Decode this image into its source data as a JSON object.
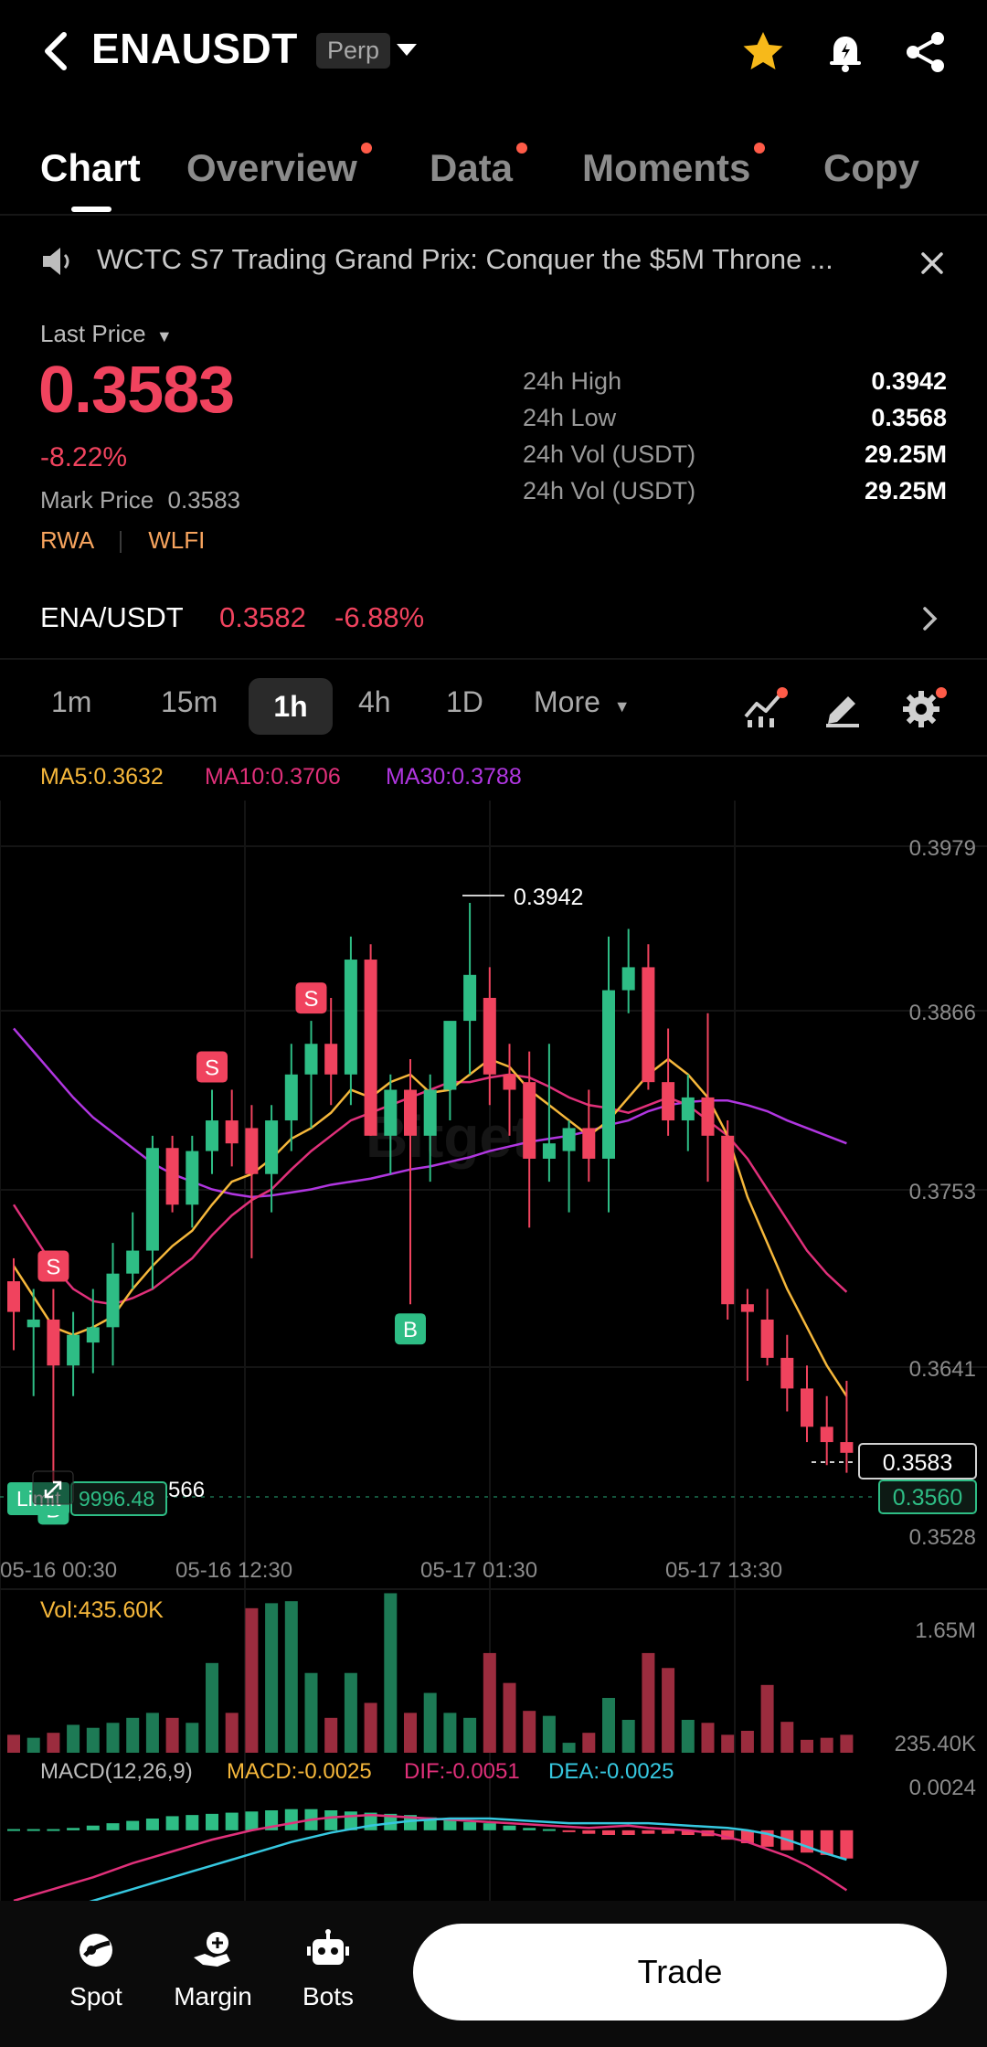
{
  "header": {
    "symbol": "ENAUSDT",
    "contract_type": "Perp"
  },
  "tabs": [
    {
      "label": "Chart"
    },
    {
      "label": "Overview"
    },
    {
      "label": "Data"
    },
    {
      "label": "Moments"
    },
    {
      "label": "Copy"
    }
  ],
  "announcement": {
    "text": "WCTC S7 Trading Grand Prix: Conquer the $5M Throne ..."
  },
  "price": {
    "selector_label": "Last Price",
    "last_price": "0.3583",
    "change_pct": "-8.22%",
    "mark_price_label": "Mark Price",
    "mark_price": "0.3583",
    "tags": [
      "RWA",
      "WLFI"
    ],
    "stats": [
      {
        "label": "24h High",
        "value": "0.3942"
      },
      {
        "label": "24h Low",
        "value": "0.3568"
      },
      {
        "label": "24h Vol (USDT)",
        "value": "29.25M"
      },
      {
        "label": "24h Vol (USDT)",
        "value": "29.25M"
      }
    ]
  },
  "pair": {
    "name": "ENA/USDT",
    "price": "0.3582",
    "change": "-6.88%"
  },
  "intervals": [
    "1m",
    "15m",
    "1h",
    "4h",
    "1D",
    "More"
  ],
  "colors": {
    "up": "#2ebd85",
    "down": "#f0435e",
    "ma5": "#f5b73b",
    "ma10": "#e0307a",
    "ma30": "#b036e0",
    "dea": "#36c8e0",
    "accent_dot": "#ff5b48",
    "star": "#f7b91a"
  },
  "icons": [
    "back-arrow-icon",
    "star-icon",
    "bell-icon",
    "share-icon",
    "speaker-icon",
    "close-icon",
    "chevron-right-icon",
    "indicator-icon",
    "pencil-icon",
    "gear-icon",
    "spot-icon",
    "margin-icon",
    "bots-icon"
  ],
  "chart": {
    "ma_legend": {
      "ma5": "MA5:0.3632",
      "ma10": "MA10:0.3706",
      "ma30": "MA30:0.3788"
    },
    "y_ticks": [
      "0.3979",
      "0.3866",
      "0.3753",
      "0.3641",
      "0.3528"
    ],
    "x_ticks": [
      "05-16 00:30",
      "05-16 12:30",
      "05-17 01:30",
      "05-17 13:30"
    ],
    "high_marker": "0.3942",
    "last_price_tag": "0.3583",
    "order_price_tag": "0.3560",
    "order": {
      "type": "Limit",
      "qty": "9996.48",
      "price_fragment": "566"
    },
    "vol_label": "Vol:435.60K",
    "vol_ticks": [
      "1.65M",
      "235.40K"
    ],
    "macd": {
      "label": "MACD(12,26,9)",
      "macd": "MACD:-0.0025",
      "dif": "DIF:-0.0051",
      "dea": "DEA:-0.0025",
      "tick": "0.0024"
    },
    "trade_markers": [
      "S",
      "S",
      "S",
      "B",
      "B"
    ]
  },
  "chart_data": {
    "type": "candlestick",
    "y_range": [
      0.3528,
      0.3979
    ],
    "candles": [
      {
        "o": 0.3695,
        "h": 0.371,
        "l": 0.365,
        "c": 0.3675
      },
      {
        "o": 0.3665,
        "h": 0.369,
        "l": 0.362,
        "c": 0.367
      },
      {
        "o": 0.367,
        "h": 0.369,
        "l": 0.356,
        "c": 0.364
      },
      {
        "o": 0.364,
        "h": 0.3675,
        "l": 0.362,
        "c": 0.366
      },
      {
        "o": 0.3655,
        "h": 0.369,
        "l": 0.3635,
        "c": 0.3665
      },
      {
        "o": 0.3665,
        "h": 0.372,
        "l": 0.364,
        "c": 0.37
      },
      {
        "o": 0.37,
        "h": 0.374,
        "l": 0.369,
        "c": 0.3715
      },
      {
        "o": 0.3715,
        "h": 0.379,
        "l": 0.369,
        "c": 0.3782
      },
      {
        "o": 0.3782,
        "h": 0.379,
        "l": 0.374,
        "c": 0.3745
      },
      {
        "o": 0.3745,
        "h": 0.379,
        "l": 0.373,
        "c": 0.378
      },
      {
        "o": 0.378,
        "h": 0.382,
        "l": 0.3765,
        "c": 0.38
      },
      {
        "o": 0.38,
        "h": 0.382,
        "l": 0.377,
        "c": 0.3785
      },
      {
        "o": 0.3795,
        "h": 0.381,
        "l": 0.371,
        "c": 0.3765
      },
      {
        "o": 0.3765,
        "h": 0.381,
        "l": 0.374,
        "c": 0.38
      },
      {
        "o": 0.38,
        "h": 0.385,
        "l": 0.378,
        "c": 0.383
      },
      {
        "o": 0.383,
        "h": 0.3865,
        "l": 0.3795,
        "c": 0.385
      },
      {
        "o": 0.385,
        "h": 0.388,
        "l": 0.381,
        "c": 0.383
      },
      {
        "o": 0.383,
        "h": 0.392,
        "l": 0.381,
        "c": 0.3905
      },
      {
        "o": 0.3905,
        "h": 0.3915,
        "l": 0.379,
        "c": 0.379
      },
      {
        "o": 0.379,
        "h": 0.383,
        "l": 0.3765,
        "c": 0.382
      },
      {
        "o": 0.382,
        "h": 0.384,
        "l": 0.368,
        "c": 0.379
      },
      {
        "o": 0.379,
        "h": 0.383,
        "l": 0.376,
        "c": 0.382
      },
      {
        "o": 0.382,
        "h": 0.386,
        "l": 0.38,
        "c": 0.3865
      },
      {
        "o": 0.3865,
        "h": 0.3942,
        "l": 0.383,
        "c": 0.3895
      },
      {
        "o": 0.388,
        "h": 0.39,
        "l": 0.381,
        "c": 0.383
      },
      {
        "o": 0.383,
        "h": 0.385,
        "l": 0.379,
        "c": 0.382
      },
      {
        "o": 0.3825,
        "h": 0.3845,
        "l": 0.373,
        "c": 0.3775
      },
      {
        "o": 0.3775,
        "h": 0.385,
        "l": 0.376,
        "c": 0.3785
      },
      {
        "o": 0.378,
        "h": 0.38,
        "l": 0.374,
        "c": 0.3795
      },
      {
        "o": 0.3795,
        "h": 0.382,
        "l": 0.376,
        "c": 0.3775
      },
      {
        "o": 0.3775,
        "h": 0.392,
        "l": 0.374,
        "c": 0.3885
      },
      {
        "o": 0.3885,
        "h": 0.3925,
        "l": 0.387,
        "c": 0.39
      },
      {
        "o": 0.39,
        "h": 0.3915,
        "l": 0.382,
        "c": 0.3825
      },
      {
        "o": 0.3825,
        "h": 0.386,
        "l": 0.379,
        "c": 0.38
      },
      {
        "o": 0.38,
        "h": 0.383,
        "l": 0.378,
        "c": 0.3815
      },
      {
        "o": 0.3815,
        "h": 0.387,
        "l": 0.376,
        "c": 0.379
      },
      {
        "o": 0.379,
        "h": 0.38,
        "l": 0.367,
        "c": 0.368
      },
      {
        "o": 0.368,
        "h": 0.369,
        "l": 0.363,
        "c": 0.3675
      },
      {
        "o": 0.367,
        "h": 0.369,
        "l": 0.364,
        "c": 0.3645
      },
      {
        "o": 0.3645,
        "h": 0.366,
        "l": 0.361,
        "c": 0.3625
      },
      {
        "o": 0.3625,
        "h": 0.364,
        "l": 0.359,
        "c": 0.36
      },
      {
        "o": 0.36,
        "h": 0.362,
        "l": 0.3575,
        "c": 0.359
      },
      {
        "o": 0.359,
        "h": 0.363,
        "l": 0.357,
        "c": 0.3583
      }
    ],
    "ma5": [
      0.3705,
      0.3685,
      0.3665,
      0.366,
      0.3665,
      0.3672,
      0.369,
      0.3705,
      0.3718,
      0.3728,
      0.3745,
      0.376,
      0.3765,
      0.3775,
      0.3788,
      0.3795,
      0.3805,
      0.382,
      0.3815,
      0.3825,
      0.383,
      0.3818,
      0.382,
      0.383,
      0.384,
      0.3835,
      0.382,
      0.381,
      0.38,
      0.379,
      0.38,
      0.3815,
      0.383,
      0.384,
      0.383,
      0.3815,
      0.379,
      0.375,
      0.372,
      0.369,
      0.3665,
      0.364,
      0.362
    ],
    "ma10": [
      0.3745,
      0.3725,
      0.3705,
      0.369,
      0.3682,
      0.368,
      0.3684,
      0.369,
      0.37,
      0.371,
      0.3725,
      0.3738,
      0.3748,
      0.3755,
      0.3768,
      0.378,
      0.379,
      0.38,
      0.3805,
      0.381,
      0.3815,
      0.382,
      0.3825,
      0.3825,
      0.3828,
      0.383,
      0.3828,
      0.3822,
      0.3815,
      0.381,
      0.3808,
      0.3805,
      0.381,
      0.3815,
      0.381,
      0.38,
      0.379,
      0.3775,
      0.3755,
      0.3735,
      0.3715,
      0.37,
      0.3688
    ],
    "ma30": [
      0.386,
      0.3845,
      0.383,
      0.3815,
      0.3802,
      0.3792,
      0.3782,
      0.3772,
      0.3765,
      0.376,
      0.3755,
      0.3752,
      0.375,
      0.3751,
      0.3753,
      0.3755,
      0.3758,
      0.376,
      0.3762,
      0.3765,
      0.3768,
      0.377,
      0.3773,
      0.3776,
      0.378,
      0.3783,
      0.3786,
      0.3788,
      0.379,
      0.3793,
      0.3797,
      0.38,
      0.3806,
      0.381,
      0.3812,
      0.3813,
      0.3813,
      0.381,
      0.3806,
      0.38,
      0.3795,
      0.379,
      0.3785
    ],
    "volume_range": [
      0,
      1.65
    ],
    "volume": [
      0.18,
      0.15,
      0.2,
      0.28,
      0.25,
      0.3,
      0.35,
      0.4,
      0.35,
      0.3,
      0.9,
      0.4,
      1.45,
      1.5,
      1.52,
      0.8,
      0.35,
      0.8,
      0.5,
      1.6,
      0.4,
      0.6,
      0.4,
      0.35,
      1.0,
      0.7,
      0.42,
      0.37,
      0.1,
      0.2,
      0.55,
      0.33,
      1.0,
      0.85,
      0.33,
      0.3,
      0.18,
      0.22,
      0.68,
      0.31,
      0.13,
      0.15,
      0.18
    ],
    "macd_range": [
      -0.006,
      0.0024
    ],
    "macd_hist": [
      0.0001,
      0.0001,
      0.0001,
      0.0002,
      0.0004,
      0.0006,
      0.0008,
      0.001,
      0.0012,
      0.0013,
      0.0014,
      0.0015,
      0.0016,
      0.0017,
      0.0018,
      0.0018,
      0.0017,
      0.0016,
      0.0015,
      0.0014,
      0.0013,
      0.0011,
      0.0009,
      0.0007,
      0.0006,
      0.0004,
      0.0002,
      0.0001,
      -0.0001,
      -0.0003,
      -0.0004,
      -0.0004,
      -0.0003,
      -0.0003,
      -0.0004,
      -0.0005,
      -0.0008,
      -0.0011,
      -0.0014,
      -0.0017,
      -0.0019,
      -0.0021,
      -0.0024
    ],
    "dif": [
      -0.006,
      -0.0055,
      -0.005,
      -0.0045,
      -0.004,
      -0.0034,
      -0.0028,
      -0.0023,
      -0.0018,
      -0.0013,
      -0.0008,
      -0.0004,
      0.0,
      0.0003,
      0.0006,
      0.0009,
      0.0011,
      0.0012,
      0.0013,
      0.0012,
      0.0011,
      0.001,
      0.0009,
      0.0008,
      0.0007,
      0.0006,
      0.0005,
      0.0004,
      0.0003,
      0.0002,
      0.0003,
      0.0004,
      0.0002,
      0.0001,
      0.0,
      -0.0002,
      -0.0006,
      -0.001,
      -0.0016,
      -0.0022,
      -0.003,
      -0.004,
      -0.0051
    ],
    "dea": [
      -0.008,
      -0.0075,
      -0.007,
      -0.0065,
      -0.006,
      -0.0055,
      -0.005,
      -0.0045,
      -0.004,
      -0.0035,
      -0.003,
      -0.0025,
      -0.002,
      -0.0015,
      -0.001,
      -0.0006,
      -0.0002,
      0.0001,
      0.0004,
      0.0006,
      0.0008,
      0.0009,
      0.001,
      0.001,
      0.001,
      0.0009,
      0.0008,
      0.0007,
      0.0006,
      0.0006,
      0.0006,
      0.0006,
      0.0006,
      0.0005,
      0.0004,
      0.0003,
      0.0002,
      0.0,
      -0.0003,
      -0.0008,
      -0.0014,
      -0.002,
      -0.0025
    ]
  }
}
